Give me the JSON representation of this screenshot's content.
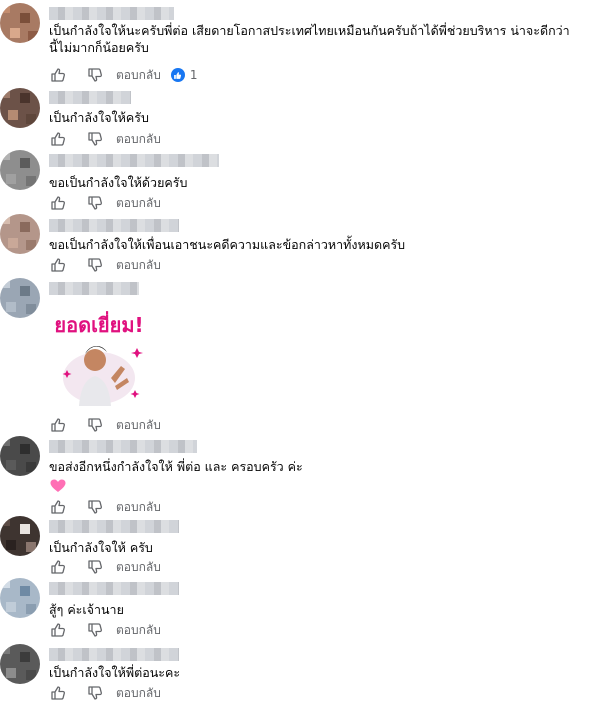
{
  "comments": [
    {
      "text": "เป็นกำลังใจให้นะครับพี่ต่อ เสียดายโอกาสประเทศไทยเหมือนกันครับถ้าได้พี่ช่วยบริหาร น่าจะดีกว่า\nนี้ไม่มากก็น้อยครับ",
      "reply_label": "ตอบกลับ",
      "reaction_count": "1"
    },
    {
      "text": "เป็นกำลังใจให้ครับ",
      "reply_label": "ตอบกลับ"
    },
    {
      "text": "ขอเป็นกำลังใจให้ด้วยครับ",
      "reply_label": "ตอบกลับ"
    },
    {
      "text": "ขอเป็นกำลังใจให้เพื่อนเอาชนะคดีความและข้อกล่าวหาทั้งหมดครับ",
      "reply_label": "ตอบกลับ"
    },
    {
      "sticker_text": "ยอดเยี่ยม!",
      "reply_label": "ตอบกลับ"
    },
    {
      "text": "ขอส่งอีกหนึ่งกำลังใจให้ พี่ต่อ และ ครอบครัว ค่ะ",
      "emoji": "pink-heart",
      "reply_label": "ตอบกลับ"
    },
    {
      "text": "เป็นกำลังใจให้ ครับ",
      "reply_label": "ตอบกลับ"
    },
    {
      "text": "สู้ๆ ค่ะเจ้านาย",
      "reply_label": "ตอบกลับ"
    },
    {
      "text": "เป็นกำลังใจให้พี่ต่อนะคะ",
      "reply_label": "ตอบกลับ"
    }
  ],
  "colors": {
    "reaction": "#1877f2",
    "secondary_text": "#65676b",
    "heart": "#ff6fb5",
    "sticker_text": "#e0117f"
  },
  "icons": {
    "like": "thumbs-up-icon",
    "dislike": "thumbs-down-icon",
    "reaction": "like-reaction-icon"
  }
}
